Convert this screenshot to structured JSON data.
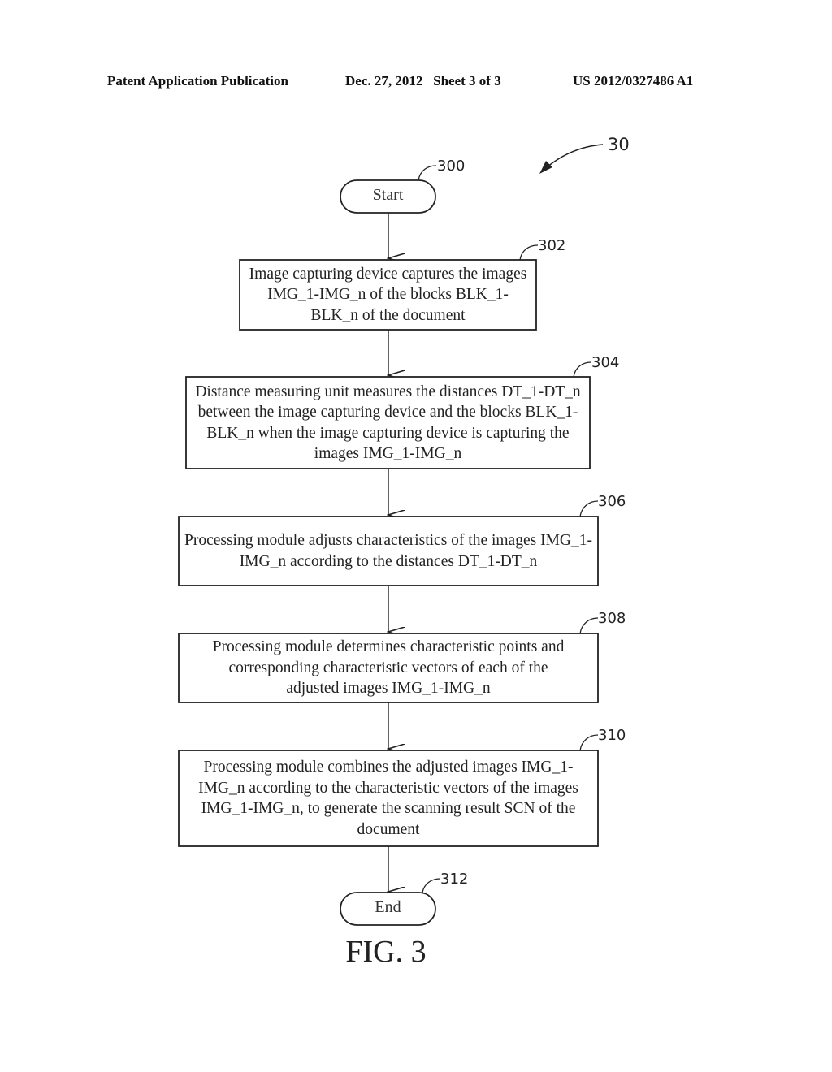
{
  "header": {
    "left": "Patent Application Publication",
    "middle": "Dec. 27, 2012   Sheet 3 of 3",
    "right": "US 2012/0327486 A1"
  },
  "figure": {
    "label": "FIG. 3",
    "ref": "30",
    "start": {
      "ref": "300",
      "text": "Start"
    },
    "steps": [
      {
        "ref": "302",
        "text": "Image capturing device captures the images IMG_1-IMG_n of the blocks BLK_1-BLK_n of the document"
      },
      {
        "ref": "304",
        "text": "Distance measuring unit measures the distances DT_1-DT_n between the image capturing device and the blocks BLK_1-BLK_n when the image capturing device is capturing the images IMG_1-IMG_n"
      },
      {
        "ref": "306",
        "text": "Processing module adjusts characteristics of the images IMG_1-IMG_n according to the distances DT_1-DT_n"
      },
      {
        "ref": "308",
        "text": "Processing module determines characteristic points and corresponding characteristic vectors of each of the adjusted images IMG_1-IMG_n"
      },
      {
        "ref": "310",
        "text": "Processing module combines the adjusted images IMG_1-IMG_n according to the characteristic vectors of the images IMG_1-IMG_n, to generate the scanning result SCN of the document"
      }
    ],
    "end": {
      "ref": "312",
      "text": "End"
    }
  }
}
